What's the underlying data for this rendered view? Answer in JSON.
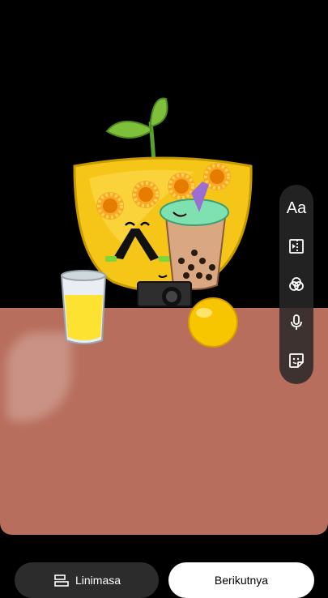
{
  "toolbar": {
    "text_label": "Aa",
    "items": [
      "text-tool",
      "media-tool",
      "filter-tool",
      "voice-tool",
      "sticker-tool"
    ]
  },
  "bottom": {
    "timeline_label": "Linimasa",
    "next_label": "Berikutnya"
  },
  "colors": {
    "table": "#b86e5c",
    "background": "#000000",
    "toolbar": "#282828"
  }
}
